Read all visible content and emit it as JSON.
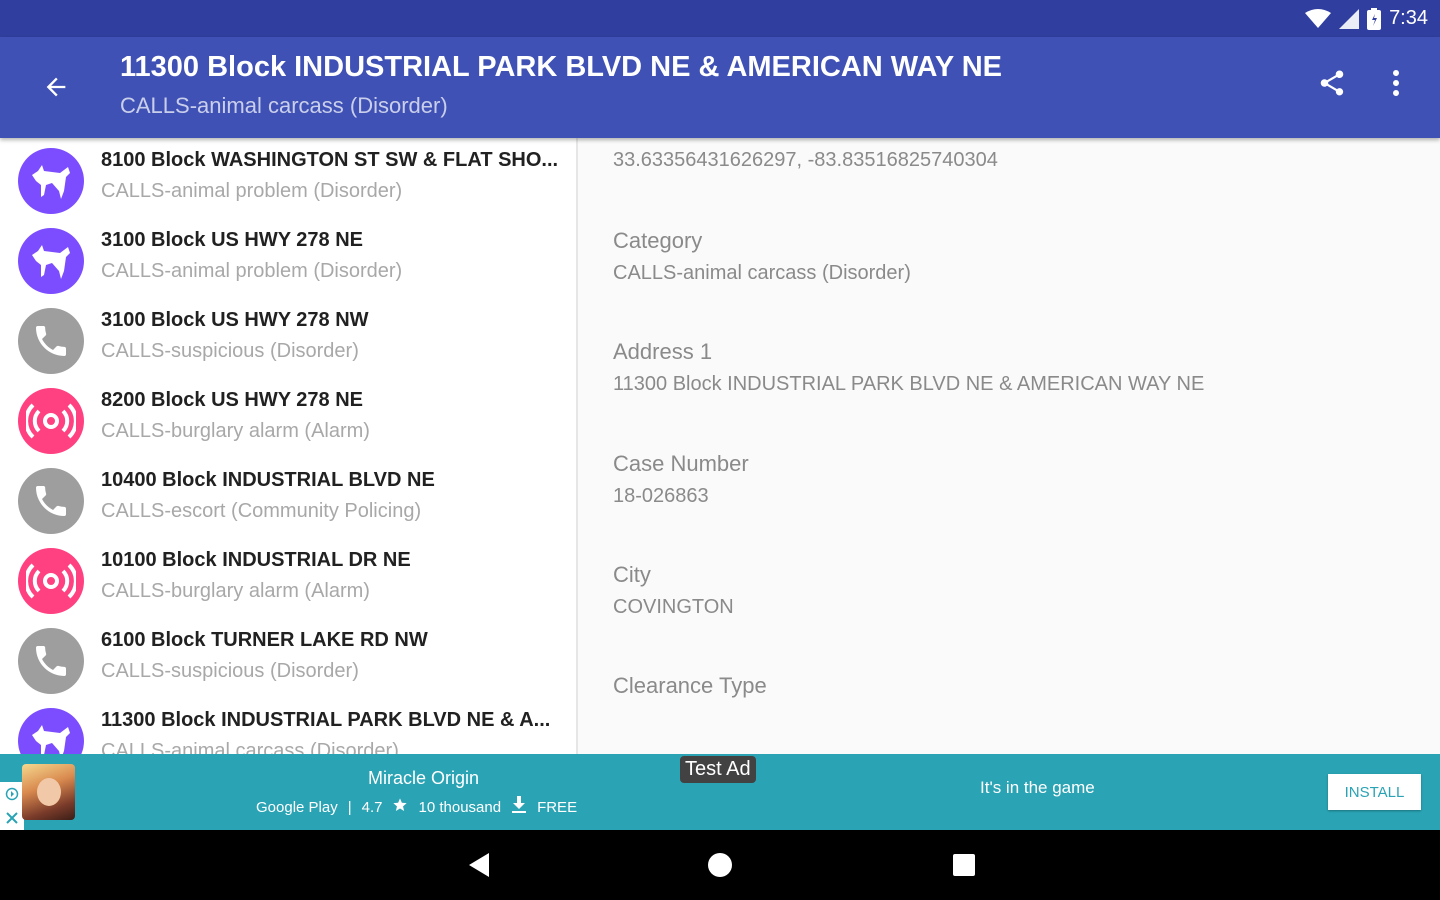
{
  "status_bar": {
    "time": "7:34",
    "icons": [
      "wifi-icon",
      "signal-icon",
      "battery-icon"
    ]
  },
  "app_bar": {
    "title": "11300 Block INDUSTRIAL PARK BLVD NE & AMERICAN WAY NE",
    "subtitle": "CALLS-animal carcass (Disorder)",
    "icons": [
      "back-arrow-icon",
      "share-icon",
      "more-vert-icon"
    ]
  },
  "list": {
    "items": [
      {
        "title": "8100 Block WASHINGTON ST SW & FLAT SHO...",
        "subtitle": "CALLS-animal problem (Disorder)",
        "icon": "animal-icon"
      },
      {
        "title": "3100 Block US HWY 278 NE",
        "subtitle": "CALLS-animal problem (Disorder)",
        "icon": "animal-icon"
      },
      {
        "title": "3100 Block US HWY 278 NW",
        "subtitle": "CALLS-suspicious (Disorder)",
        "icon": "phone-icon"
      },
      {
        "title": "8200 Block US HWY 278 NE",
        "subtitle": "CALLS-burglary alarm (Alarm)",
        "icon": "alarm-icon"
      },
      {
        "title": "10400 Block INDUSTRIAL BLVD NE",
        "subtitle": "CALLS-escort (Community Policing)",
        "icon": "phone-icon"
      },
      {
        "title": "10100 Block INDUSTRIAL DR NE",
        "subtitle": "CALLS-burglary alarm (Alarm)",
        "icon": "alarm-icon"
      },
      {
        "title": "6100 Block TURNER LAKE RD NW",
        "subtitle": "CALLS-suspicious (Disorder)",
        "icon": "phone-icon"
      },
      {
        "title": "11300 Block INDUSTRIAL PARK BLVD NE & A...",
        "subtitle": "CALLS-animal carcass (Disorder)",
        "icon": "animal-icon"
      }
    ]
  },
  "detail": {
    "coordinates_value": "33.63356431626297, -83.83516825740304",
    "fields": [
      {
        "label": "Category",
        "value": "CALLS-animal carcass (Disorder)"
      },
      {
        "label": "Address 1",
        "value": "11300 Block INDUSTRIAL PARK BLVD NE & AMERICAN WAY NE"
      },
      {
        "label": "Case Number",
        "value": "18-026863"
      },
      {
        "label": "City",
        "value": "COVINGTON"
      },
      {
        "label": "Clearance Type",
        "value": ""
      }
    ]
  },
  "ad": {
    "test_label": "Test Ad",
    "app_name": "Miracle Origin",
    "store": "Google Play",
    "rating": "4.7",
    "downloads": "10 thousand",
    "price": "FREE",
    "tagline": "It's in the game",
    "install_label": "INSTALL"
  },
  "colors": {
    "status_bar": "#303f9f",
    "app_bar": "#3f51b5",
    "animal_avatar": "#7c4dff",
    "phone_avatar": "#9e9e9e",
    "alarm_avatar": "#ff4081",
    "ad_background": "#2aa3b4"
  }
}
